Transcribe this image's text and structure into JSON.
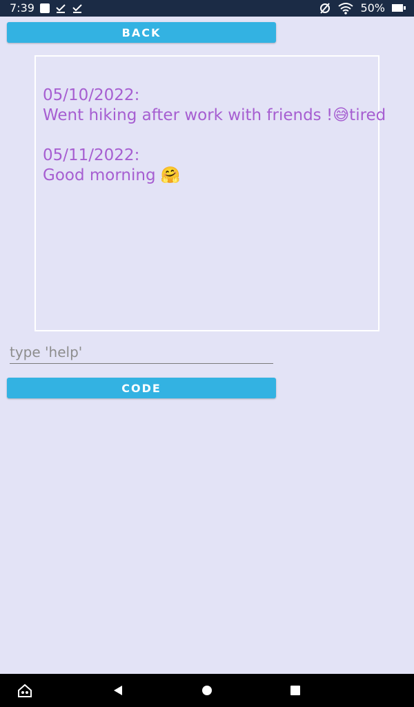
{
  "status_bar": {
    "time": "7:39",
    "battery": "50%",
    "icons": [
      "notification-square-icon",
      "check-icon",
      "check-icon",
      "no-sim-icon",
      "wifi-icon",
      "battery-icon"
    ]
  },
  "back_button": {
    "label": "BACK"
  },
  "journal": {
    "entries": [
      {
        "date": "05/10/2022:",
        "text": "Went hiking after work with friends !😅tired"
      },
      {
        "date": "05/11/2022:",
        "text": "Good morning 🤗"
      }
    ]
  },
  "command_input": {
    "placeholder": "type 'help'",
    "value": ""
  },
  "code_button": {
    "label": "CODE"
  },
  "nav_bar": {
    "icons": [
      "home-icon",
      "back-icon",
      "home-circle-icon",
      "recents-icon"
    ]
  },
  "colors": {
    "background": "#e3e3f6",
    "button": "#33b2e2",
    "entry_text": "#a65ed1",
    "status_bar": "#1b2b45"
  }
}
